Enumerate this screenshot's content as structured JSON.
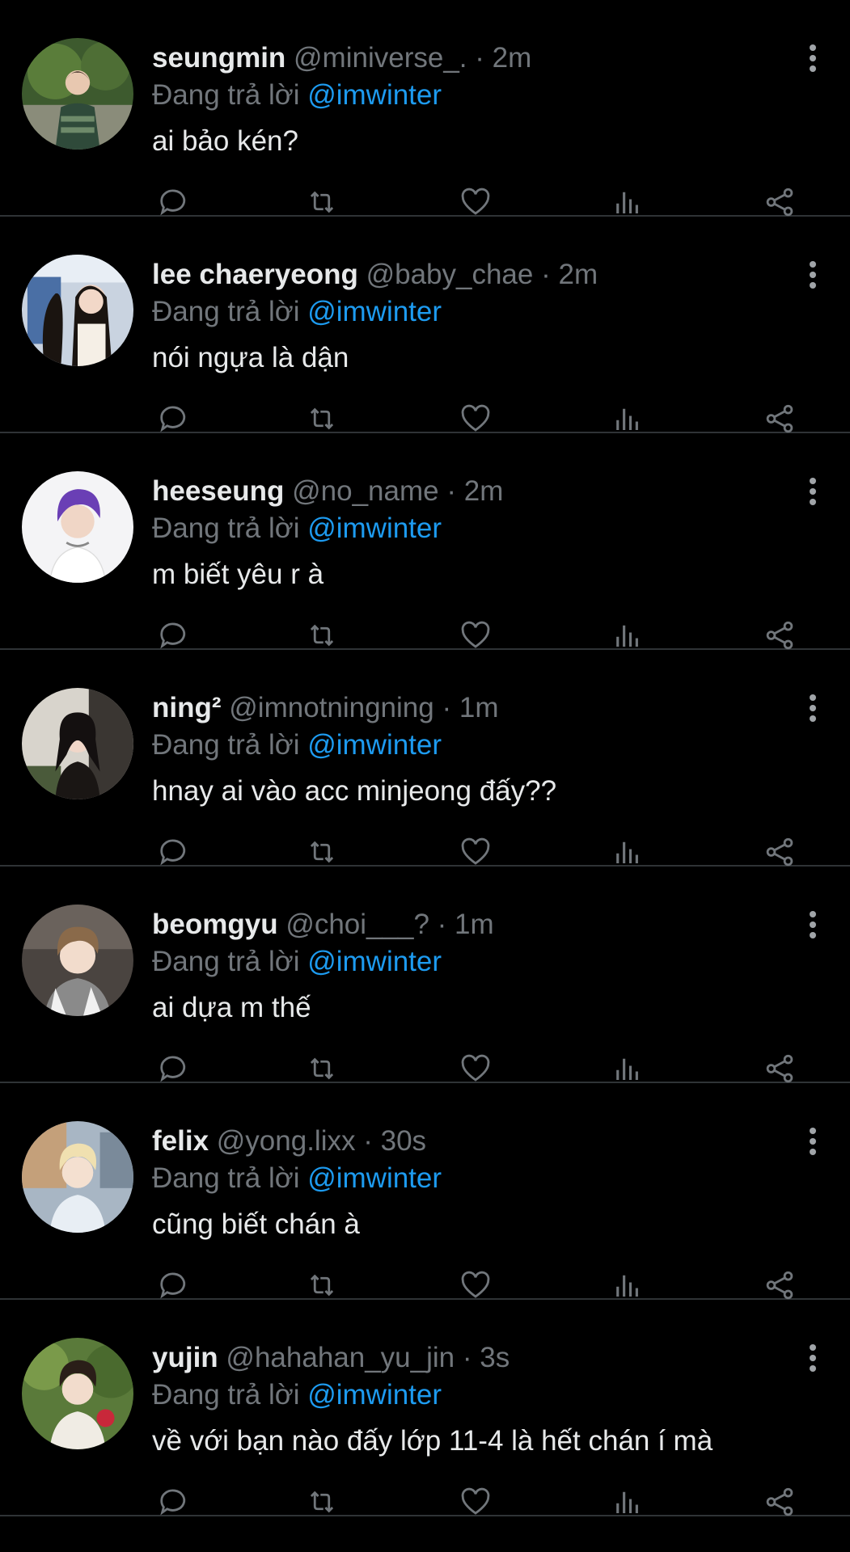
{
  "reply_prefix": "Đang trả lời",
  "tweets": [
    {
      "name": "seungmin",
      "handle": "@miniverse_.",
      "sep": "·",
      "time": "2m",
      "reply_to": "@imwinter",
      "text": "ai bảo kén?"
    },
    {
      "name": "lee chaeryeong",
      "handle": "@baby_chae",
      "sep": "·",
      "time": "2m",
      "reply_to": "@imwinter",
      "text": "nói ngựa là dận"
    },
    {
      "name": "heeseung",
      "handle": "@no_name",
      "sep": "·",
      "time": "2m",
      "reply_to": "@imwinter",
      "text": "m biết yêu r à"
    },
    {
      "name": "ning²",
      "handle": "@imnotningning",
      "sep": "·",
      "time": "1m",
      "reply_to": "@imwinter",
      "text": "hnay ai vào acc minjeong đấy??"
    },
    {
      "name": "beomgyu",
      "handle": "@choi___?",
      "sep": "·",
      "time": "1m",
      "reply_to": "@imwinter",
      "text": "ai dựa m thế"
    },
    {
      "name": "felix",
      "handle": "@yong.lixx",
      "sep": "·",
      "time": "30s",
      "reply_to": "@imwinter",
      "text": "cũng biết chán à"
    },
    {
      "name": "yujin",
      "handle": "@hahahan_yu_jin",
      "sep": "·",
      "time": "3s",
      "reply_to": "@imwinter",
      "text": "về với bạn nào đấy lớp 11-4 là hết chán í mà"
    }
  ],
  "icons": {
    "more": "more-vertical-icon",
    "reply": "reply-icon",
    "retweet": "retweet-icon",
    "like": "like-icon",
    "views": "views-icon",
    "share": "share-icon"
  },
  "colors": {
    "background": "#000000",
    "text": "#e7e9ea",
    "muted": "#71767b",
    "accent": "#1d9bf0",
    "divider": "#2f3336"
  }
}
